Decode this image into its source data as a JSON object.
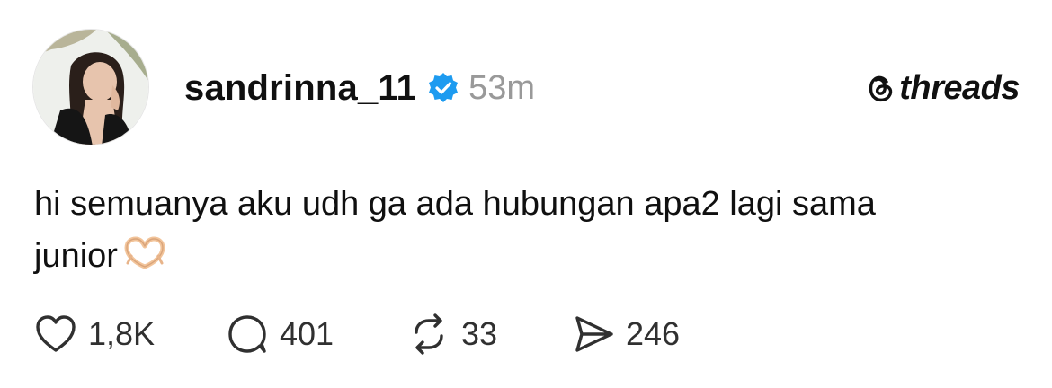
{
  "post": {
    "username": "sandrinna_11",
    "verified_icon": "verified-badge-icon",
    "verified_color": "#1d9bf0",
    "timestamp": "53m",
    "brand": "threads",
    "text_line1": "hi semuanya aku udh ga ada hubungan apa2 lagi sama",
    "text_line2": "junior",
    "emoji": "heart-hands-emoji"
  },
  "actions": {
    "likes": "1,8K",
    "replies": "401",
    "reposts": "33",
    "shares": "246"
  }
}
